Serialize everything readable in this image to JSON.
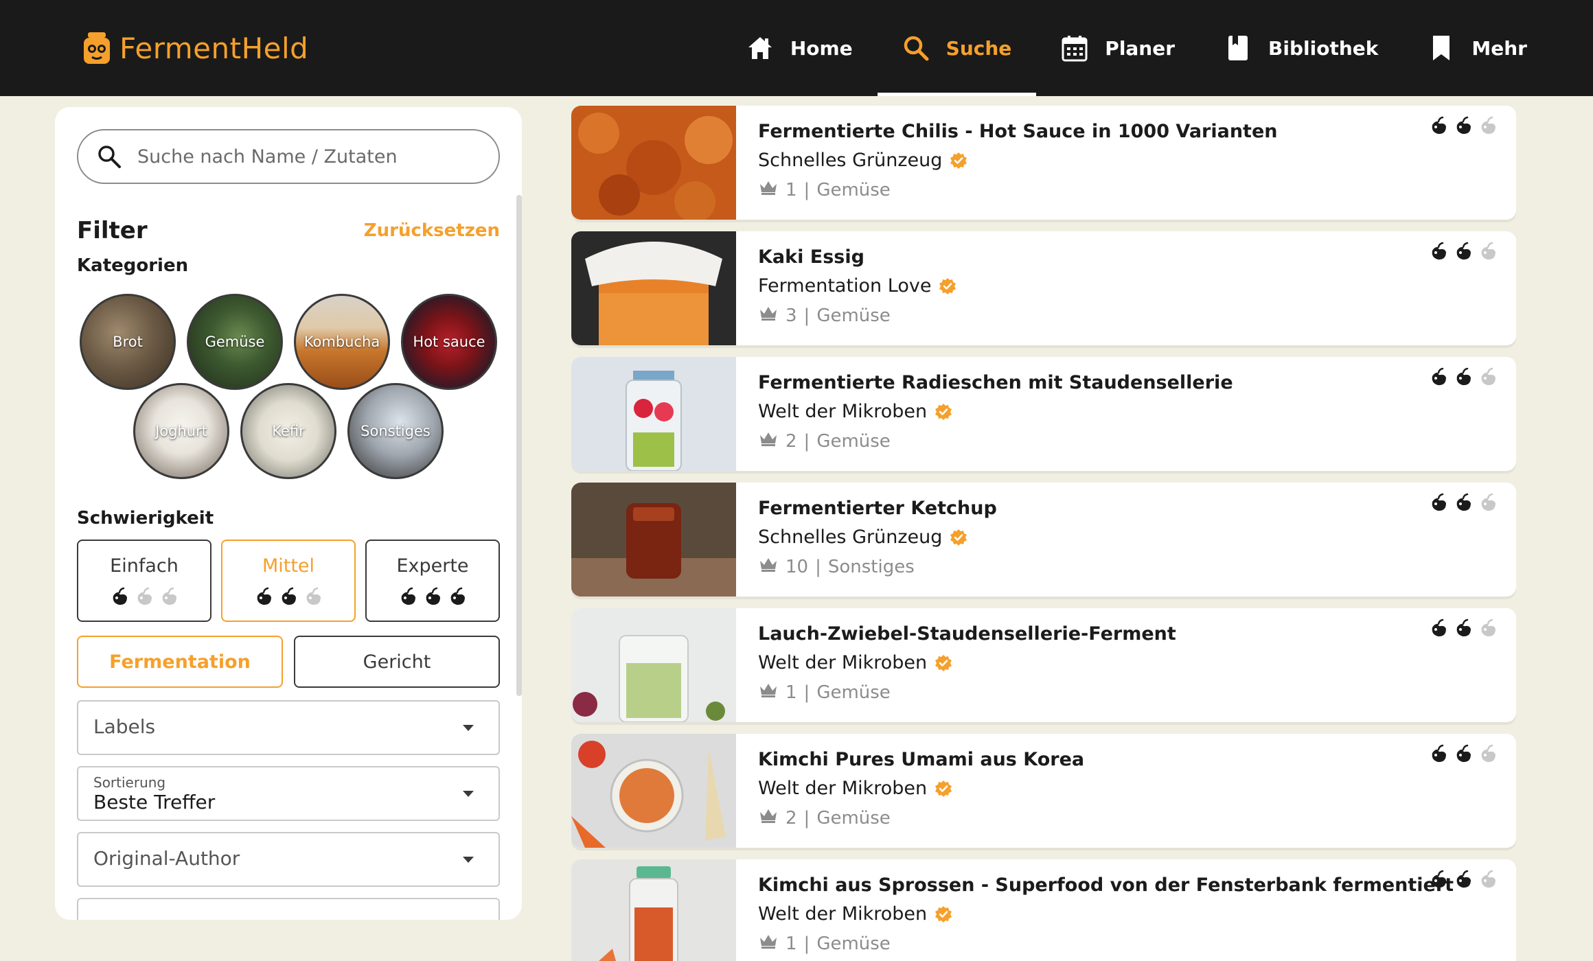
{
  "app": {
    "name": "FermentHeld",
    "colors": {
      "accent": "#f5a02c",
      "topbar": "#1a1a1a",
      "background": "#f1efe2"
    }
  },
  "nav": {
    "items": [
      {
        "label": "Home",
        "icon": "home-icon"
      },
      {
        "label": "Suche",
        "icon": "search-icon",
        "active": true
      },
      {
        "label": "Planer",
        "icon": "calendar-icon"
      },
      {
        "label": "Bibliothek",
        "icon": "book-icon"
      },
      {
        "label": "Mehr",
        "icon": "bookmark-icon"
      }
    ]
  },
  "search": {
    "placeholder": "Suche nach Name / Zutaten",
    "value": ""
  },
  "filter": {
    "title": "Filter",
    "reset_label": "Zurücksetzen",
    "categories_label": "Kategorien",
    "categories": [
      "Brot",
      "Gemüse",
      "Kombucha",
      "Hot sauce",
      "Joghurt",
      "Kefir",
      "Sonstiges"
    ],
    "difficulty_label": "Schwierigkeit",
    "difficulty": [
      {
        "label": "Einfach",
        "level": 1
      },
      {
        "label": "Mittel",
        "level": 2,
        "active": true
      },
      {
        "label": "Experte",
        "level": 3
      }
    ],
    "types": [
      {
        "label": "Fermentation",
        "active": true
      },
      {
        "label": "Gericht"
      }
    ],
    "labels_select": "Labels",
    "sort_label": "Sortierung",
    "sort_value": "Beste Treffer",
    "author_select": "Original-Author"
  },
  "results": [
    {
      "title": "Fermentierte Chilis - Hot Sauce in 1000 Varianten",
      "author": "Schnelles Grünzeug",
      "count": "1",
      "category": "Gemüse",
      "difficulty": 2
    },
    {
      "title": "Kaki Essig",
      "author": "Fermentation Love",
      "count": "3",
      "category": "Gemüse",
      "difficulty": 2
    },
    {
      "title": "Fermentierte Radieschen mit Staudensellerie",
      "author": "Welt der Mikroben",
      "count": "2",
      "category": "Gemüse",
      "difficulty": 2
    },
    {
      "title": "Fermentierter Ketchup",
      "author": "Schnelles Grünzeug",
      "count": "10",
      "category": "Sonstiges",
      "difficulty": 2
    },
    {
      "title": "Lauch-Zwiebel-Staudensellerie-Ferment",
      "author": "Welt der Mikroben",
      "count": "1",
      "category": "Gemüse",
      "difficulty": 2
    },
    {
      "title": "Kimchi Pures Umami aus Korea",
      "author": "Welt der Mikroben",
      "count": "2",
      "category": "Gemüse",
      "difficulty": 2
    },
    {
      "title": "Kimchi aus Sprossen - Superfood von der Fensterbank fermentiert",
      "author": "Welt der Mikroben",
      "count": "1",
      "category": "Gemüse",
      "difficulty": 2
    }
  ]
}
